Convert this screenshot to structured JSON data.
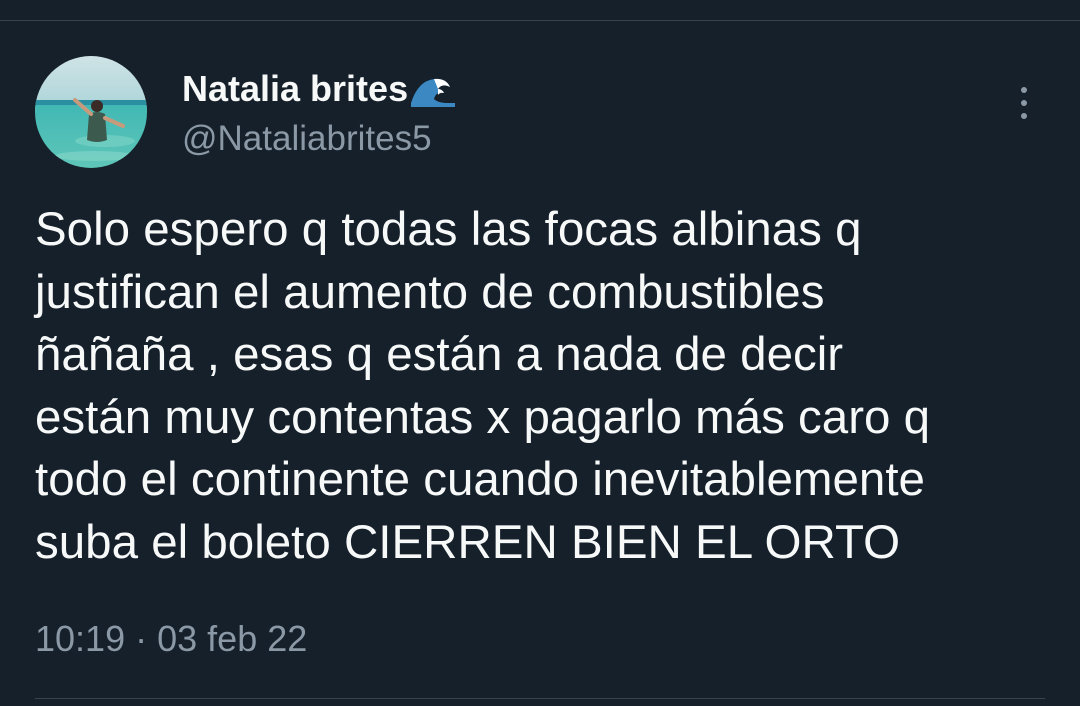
{
  "tweet": {
    "author": {
      "display_name": "Natalia brites",
      "name_emoji": "wave-emoji-icon",
      "handle": "@Nataliabrites5",
      "avatar": "profile-photo-beach"
    },
    "text_lines": [
      "Solo espero q todas las focas albinas q",
      "justifican el aumento de combustibles",
      "ñañaña , esas q están a nada de decir",
      "están muy contentas x pagarlo más caro q",
      "todo el continente cuando inevitablemente",
      "suba el boleto CIERREN BIEN EL ORTO"
    ],
    "time": "10:19",
    "separator": "·",
    "date": "03 feb 22",
    "more_icon": "more-vertical-icon"
  },
  "colors": {
    "background": "#15202b",
    "text_primary": "#f7f9f9",
    "text_secondary": "#8b98a5",
    "divider": "#38444d"
  }
}
